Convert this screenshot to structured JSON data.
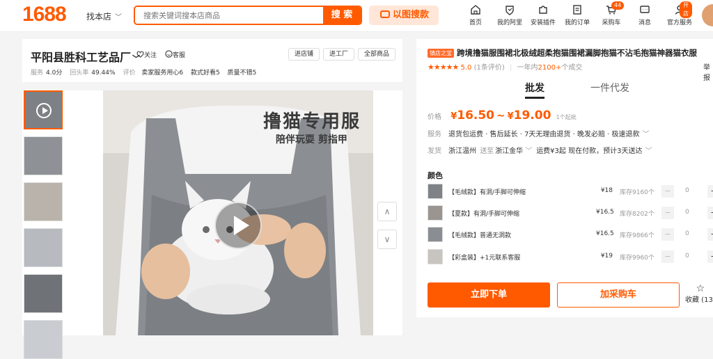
{
  "header": {
    "logo": "1688",
    "scope": "找本店",
    "search_placeholder": "搜索关键词搜本店商品",
    "search_button": "搜 索",
    "image_search": "以图搜款",
    "nav": [
      {
        "label": "首页",
        "icon": "home-icon"
      },
      {
        "label": "我的阿里",
        "icon": "heart-shield-icon"
      },
      {
        "label": "安装插件",
        "icon": "puzzle-icon"
      },
      {
        "label": "我的订单",
        "icon": "order-icon"
      },
      {
        "label": "采购车",
        "icon": "cart-icon",
        "badge": "44"
      },
      {
        "label": "消息",
        "icon": "message-icon"
      },
      {
        "label": "官方服务",
        "icon": "service-icon",
        "badge": "开店"
      }
    ]
  },
  "shop": {
    "name": "平阳县胜科工艺品厂",
    "follow": "关注",
    "service": "客服",
    "buttons": [
      "进店铺",
      "进工厂",
      "全部商品"
    ],
    "metrics": {
      "service_label": "服务",
      "service_value": "4.0分",
      "repurchase_label": "回头率",
      "repurchase_value": "49.44%",
      "eval_label": "评价",
      "eval_items": [
        "卖家服务用心6",
        "款式好看5",
        "质量不错5"
      ]
    }
  },
  "gallery": {
    "headline": "撸猫专用服",
    "subline": "陪伴玩耍 剪指甲",
    "arrow_up": "∧",
    "arrow_down": "∨"
  },
  "product": {
    "tag": "镇店之宝",
    "title": "跨境撸猫服围裙北极绒超柔抱猫围裙漏脚抱猫不沾毛抱猫神器猫衣服",
    "stars": "★★★★★",
    "score": "5.0",
    "reviews": "(1条评价)",
    "sales_prefix": "一年内",
    "sales_count": "2100+",
    "sales_suffix": "个成交",
    "side_link": "举报",
    "tab_wholesale": "批发",
    "tab_dropship": "一件代发",
    "price_label": "价格",
    "price_currency": "¥",
    "price_low": "16.50",
    "price_tilde": "~",
    "price_high": "19.00",
    "min_order": "1个起批",
    "service_label": "服务",
    "service_text": "退货包运费 · 售后延长 · 7天无理由退货 · 晚发必赔 · 极速退款",
    "ship_label": "发货",
    "ship_from": "浙江温州",
    "ship_to_label": "送至",
    "ship_to": "浙江金华",
    "ship_detail": "运费¥3起  现在付款，预计3天送达",
    "color_label": "颜色",
    "variants": [
      {
        "name": "【毛绒款】有洞/手脚可伸缩",
        "price": "¥18",
        "stock": "库存9160个",
        "qty": "0"
      },
      {
        "name": "【夏款】有洞/手脚可伸缩",
        "price": "¥16.5",
        "stock": "库存8202个",
        "qty": "0"
      },
      {
        "name": "【毛绒款】普通无洞款",
        "price": "¥16.5",
        "stock": "库存9866个",
        "qty": "0"
      },
      {
        "name": "【彩盒装】+1元联系客服",
        "price": "¥19",
        "stock": "库存9960个",
        "qty": "0"
      }
    ],
    "minus": "−",
    "plus": "+",
    "buy_button": "立即下单",
    "cart_button": "加采购车",
    "favorite": "收藏 (13)"
  },
  "colors": {
    "accent": "#ff5a00"
  }
}
